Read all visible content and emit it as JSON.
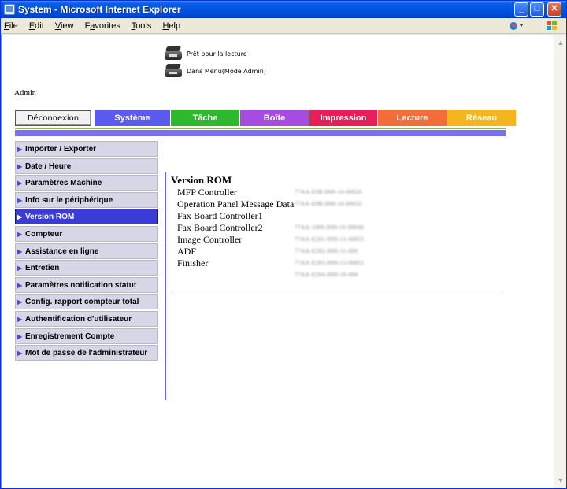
{
  "window": {
    "title": "System - Microsoft Internet Explorer"
  },
  "menubar": {
    "items": [
      {
        "label": "File",
        "ul": "F"
      },
      {
        "label": "Edit",
        "ul": "E"
      },
      {
        "label": "View",
        "ul": "V"
      },
      {
        "label": "Favorites",
        "ul": "a"
      },
      {
        "label": "Tools",
        "ul": "T"
      },
      {
        "label": "Help",
        "ul": "H"
      }
    ]
  },
  "status": {
    "line1": "Prêt pour la lecture",
    "line2": "Dans Menu(Mode Admin)"
  },
  "user": {
    "label": "Admin"
  },
  "tabs": {
    "logout": "Déconnexion",
    "items": [
      "Système",
      "Tâche",
      "Boîte",
      "Impression",
      "Lecture",
      "Réseau"
    ],
    "colors": [
      "#5b5bef",
      "#2eb82e",
      "#a64ce0",
      "#e61e5a",
      "#f26d3a",
      "#f5b51e"
    ]
  },
  "sidebar": {
    "items": [
      "Importer / Exporter",
      "Date / Heure",
      "Paramètres Machine",
      "Info sur le périphérique",
      "Version ROM",
      "Compteur",
      "Assistance en ligne",
      "Entretien",
      "Paramètres notification statut",
      "Config. rapport compteur total",
      "Authentification d'utilisateur",
      "Enregistrement Compte",
      "Mot de passe de l'administrateur"
    ],
    "active": "Version ROM"
  },
  "rom": {
    "title": "Version ROM",
    "rows": [
      {
        "name": "MFP Controller",
        "value": "77AA-E0B-D00-16-00026"
      },
      {
        "name": "Operation Panel Message Data",
        "value": "77AA-E0B-D00-16-00032"
      },
      {
        "name": "Fax Board Controller1",
        "value": ""
      },
      {
        "name": "Fax Board Controller2",
        "value": "77AA-1000-D00-16-00040"
      },
      {
        "name": "Image Controller",
        "value": "77AA-E201-D00-13-00055"
      },
      {
        "name": "ADF",
        "value": "77AA-E202-D00-11-000"
      },
      {
        "name": "Finisher",
        "value": "77AA-E203-D00-13-00051"
      },
      {
        "name": "",
        "value": "77AA-E204-D00-10-000"
      }
    ]
  }
}
